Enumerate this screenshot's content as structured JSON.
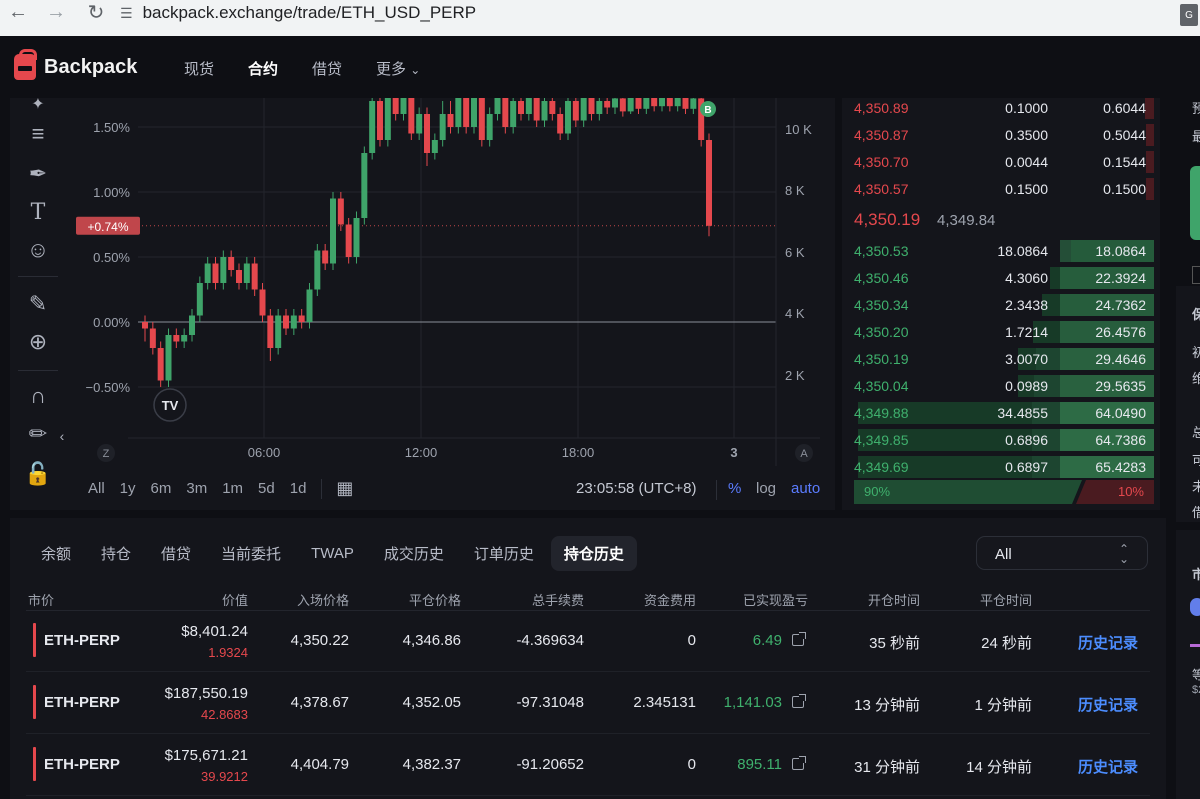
{
  "browser": {
    "url": "backpack.exchange/trade/ETH_USD_PERP"
  },
  "header": {
    "brand": "Backpack",
    "nav": [
      "现货",
      "合约",
      "借贷",
      "更多"
    ],
    "active_nav": "合约"
  },
  "chart": {
    "y_axis_pct": [
      "1.50%",
      "1.00%",
      "0.50%",
      "0.00%",
      "−0.50%"
    ],
    "y_axis_vol": [
      "10 K",
      "8 K",
      "6 K",
      "4 K",
      "2 K"
    ],
    "x_axis": [
      "06:00",
      "12:00",
      "18:00",
      "3"
    ],
    "current_marker": "+0.74%",
    "buy_marker": "B",
    "axis_corner_left": "Z",
    "axis_corner_right": "A",
    "logo": "TV",
    "timeframes": [
      "All",
      "1y",
      "6m",
      "3m",
      "1m",
      "5d",
      "1d"
    ],
    "time": "23:05:58 (UTC+8)",
    "options": [
      "%",
      "log",
      "auto"
    ],
    "accent_color": "#5b7cff",
    "up_color": "#3fa46a",
    "down_color": "#e5484d"
  },
  "chart_data": {
    "type": "candlestick",
    "xlabel": "",
    "ylabel": "",
    "x_ticks": [
      "06:00",
      "12:00",
      "18:00",
      "3"
    ],
    "y_ticks_left_pct": [
      1.5,
      1.0,
      0.5,
      0.0,
      -0.5
    ],
    "y_ticks_right": [
      "10 K",
      "8 K",
      "6 K",
      "4 K",
      "2 K"
    ],
    "ylim_pct": [
      -0.7,
      1.75
    ],
    "last_pct": 0.74,
    "grid": true,
    "candles_pct": [
      [
        0.0,
        -0.05,
        0.05,
        -0.15
      ],
      [
        -0.05,
        -0.2,
        0.0,
        -0.25
      ],
      [
        -0.2,
        -0.45,
        -0.15,
        -0.5
      ],
      [
        -0.45,
        -0.1,
        -0.05,
        -0.5
      ],
      [
        -0.1,
        -0.15,
        -0.05,
        -0.2
      ],
      [
        -0.15,
        -0.1,
        -0.05,
        -0.2
      ],
      [
        -0.1,
        0.05,
        0.1,
        -0.15
      ],
      [
        0.05,
        0.3,
        0.35,
        0.0
      ],
      [
        0.3,
        0.45,
        0.5,
        0.25
      ],
      [
        0.45,
        0.3,
        0.5,
        0.25
      ],
      [
        0.3,
        0.5,
        0.55,
        0.25
      ],
      [
        0.5,
        0.4,
        0.55,
        0.35
      ],
      [
        0.4,
        0.3,
        0.45,
        0.25
      ],
      [
        0.3,
        0.45,
        0.5,
        0.25
      ],
      [
        0.45,
        0.25,
        0.5,
        0.2
      ],
      [
        0.25,
        0.05,
        0.3,
        0.0
      ],
      [
        0.05,
        -0.2,
        0.1,
        -0.3
      ],
      [
        -0.2,
        0.05,
        0.1,
        -0.25
      ],
      [
        0.05,
        -0.05,
        0.1,
        -0.1
      ],
      [
        -0.05,
        0.05,
        0.1,
        -0.1
      ],
      [
        0.05,
        0.0,
        0.1,
        -0.05
      ],
      [
        0.0,
        0.25,
        0.3,
        -0.05
      ],
      [
        0.25,
        0.55,
        0.6,
        0.2
      ],
      [
        0.55,
        0.45,
        0.6,
        0.4
      ],
      [
        0.45,
        0.95,
        1.0,
        0.4
      ],
      [
        0.95,
        0.75,
        1.0,
        0.7
      ],
      [
        0.75,
        0.5,
        0.8,
        0.45
      ],
      [
        0.5,
        0.8,
        0.85,
        0.45
      ],
      [
        0.8,
        1.3,
        1.35,
        0.75
      ],
      [
        1.3,
        1.7,
        1.8,
        1.25
      ],
      [
        1.7,
        1.4,
        1.75,
        1.35
      ],
      [
        1.4,
        1.8,
        1.85,
        1.35
      ],
      [
        1.8,
        1.6,
        1.85,
        1.55
      ],
      [
        1.6,
        1.75,
        1.8,
        1.55
      ],
      [
        1.75,
        1.45,
        1.8,
        1.4
      ],
      [
        1.45,
        1.6,
        1.65,
        1.4
      ],
      [
        1.6,
        1.3,
        1.65,
        1.2
      ],
      [
        1.3,
        1.4,
        1.45,
        1.25
      ],
      [
        1.4,
        1.6,
        1.7,
        1.35
      ],
      [
        1.6,
        1.5,
        1.7,
        1.45
      ],
      [
        1.5,
        1.75,
        1.8,
        1.45
      ],
      [
        1.75,
        1.5,
        1.8,
        1.45
      ],
      [
        1.5,
        1.75,
        1.8,
        1.45
      ],
      [
        1.75,
        1.4,
        1.8,
        1.35
      ],
      [
        1.4,
        1.6,
        1.65,
        1.35
      ],
      [
        1.6,
        1.75,
        1.8,
        1.55
      ],
      [
        1.75,
        1.5,
        1.8,
        1.45
      ],
      [
        1.5,
        1.7,
        1.75,
        1.45
      ],
      [
        1.7,
        1.6,
        1.75,
        1.55
      ],
      [
        1.6,
        1.75,
        1.8,
        1.55
      ],
      [
        1.75,
        1.55,
        1.8,
        1.5
      ],
      [
        1.55,
        1.7,
        1.75,
        1.5
      ],
      [
        1.7,
        1.6,
        1.75,
        1.55
      ],
      [
        1.6,
        1.45,
        1.65,
        1.4
      ],
      [
        1.45,
        1.7,
        1.75,
        1.4
      ],
      [
        1.7,
        1.55,
        1.75,
        1.5
      ],
      [
        1.55,
        1.75,
        1.8,
        1.5
      ],
      [
        1.75,
        1.6,
        1.8,
        1.55
      ],
      [
        1.6,
        1.7,
        1.75,
        1.55
      ],
      [
        1.7,
        1.65,
        1.75,
        1.6
      ],
      [
        1.65,
        1.72,
        1.78,
        1.6
      ],
      [
        1.72,
        1.62,
        1.78,
        1.58
      ],
      [
        1.62,
        1.74,
        1.78,
        1.6
      ],
      [
        1.74,
        1.64,
        1.78,
        1.6
      ],
      [
        1.64,
        1.74,
        1.78,
        1.6
      ],
      [
        1.74,
        1.66,
        1.78,
        1.62
      ],
      [
        1.66,
        1.74,
        1.78,
        1.62
      ],
      [
        1.74,
        1.66,
        1.78,
        1.62
      ],
      [
        1.66,
        1.74,
        1.78,
        1.62
      ],
      [
        1.74,
        1.64,
        1.78,
        1.6
      ],
      [
        1.64,
        1.72,
        1.76,
        1.6
      ],
      [
        1.72,
        1.4,
        1.76,
        1.35
      ],
      [
        1.4,
        0.74,
        1.45,
        0.66
      ]
    ]
  },
  "orderbook": {
    "asks": [
      {
        "price": "4,350.89",
        "size": "0.1000",
        "total": "0.6044",
        "depth": 0.03
      },
      {
        "price": "4,350.87",
        "size": "0.3500",
        "total": "0.5044",
        "depth": 0.025
      },
      {
        "price": "4,350.70",
        "size": "0.0044",
        "total": "0.1544",
        "depth": 0.01
      },
      {
        "price": "4,350.57",
        "size": "0.1500",
        "total": "0.1500",
        "depth": 0.01
      }
    ],
    "last_price": "4,350.19",
    "mark_price": "4,349.84",
    "bids": [
      {
        "price": "4,350.53",
        "size": "18.0864",
        "total": "18.0864",
        "depth": 0.28,
        "size_depth": 0.0
      },
      {
        "price": "4,350.46",
        "size": "4.3060",
        "total": "22.3924",
        "depth": 0.35,
        "size_depth": 0.0
      },
      {
        "price": "4,350.34",
        "size": "2.3438",
        "total": "24.7362",
        "depth": 0.38,
        "size_depth": 0.0
      },
      {
        "price": "4,350.20",
        "size": "1.7214",
        "total": "26.4576",
        "depth": 0.41,
        "size_depth": 0.0
      },
      {
        "price": "4,350.19",
        "size": "3.0070",
        "total": "29.4646",
        "depth": 0.46,
        "size_depth": 0.6
      },
      {
        "price": "4,350.04",
        "size": "0.0989",
        "total": "29.5635",
        "depth": 0.46,
        "size_depth": 0.61
      },
      {
        "price": "4,349.88",
        "size": "34.4855",
        "total": "64.0490",
        "depth": 1.0,
        "size_depth": 0.62
      },
      {
        "price": "4,349.85",
        "size": "0.6896",
        "total": "64.7386",
        "depth": 1.0,
        "size_depth": 0.62
      },
      {
        "price": "4,349.69",
        "size": "0.6897",
        "total": "65.4283",
        "depth": 1.0,
        "size_depth": 0.62
      }
    ],
    "buy_ratio": "90%",
    "sell_ratio": "10%",
    "buy_share": 0.9
  },
  "bottom": {
    "tabs": [
      "余额",
      "持仓",
      "借贷",
      "当前委托",
      "TWAP",
      "成交历史",
      "订单历史",
      "持仓历史"
    ],
    "active_tab": "持仓历史",
    "filter": "All",
    "columns": [
      "市价",
      "价值",
      "入场价格",
      "平仓价格",
      "总手续费",
      "资金费用",
      "已实现盈亏",
      "开仓时间",
      "平仓时间"
    ],
    "rows": [
      {
        "symbol": "ETH-PERP",
        "value": "$8,401.24",
        "qty": "1.9324",
        "entry": "4,350.22",
        "close": "4,346.86",
        "fees": "-4.369634",
        "funding": "0",
        "pnl": "6.49",
        "open_time": "35 秒前",
        "close_time": "24 秒前",
        "action": "历史记录"
      },
      {
        "symbol": "ETH-PERP",
        "value": "$187,550.19",
        "qty": "42.8683",
        "entry": "4,378.67",
        "close": "4,352.05",
        "fees": "-97.31048",
        "funding": "2.345131",
        "pnl": "1,141.03",
        "open_time": "13 分钟前",
        "close_time": "1 分钟前",
        "action": "历史记录"
      },
      {
        "symbol": "ETH-PERP",
        "value": "$175,671.21",
        "qty": "39.9212",
        "entry": "4,404.79",
        "close": "4,382.37",
        "fees": "-91.20652",
        "funding": "0",
        "pnl": "895.11",
        "open_time": "31 分钟前",
        "close_time": "14 分钟前",
        "action": "历史记录"
      }
    ]
  },
  "right_edge": {
    "labels": [
      "预",
      "最",
      "保",
      "初",
      "维",
      "总",
      "可",
      "未",
      "借",
      "市",
      "等",
      "$2"
    ]
  }
}
